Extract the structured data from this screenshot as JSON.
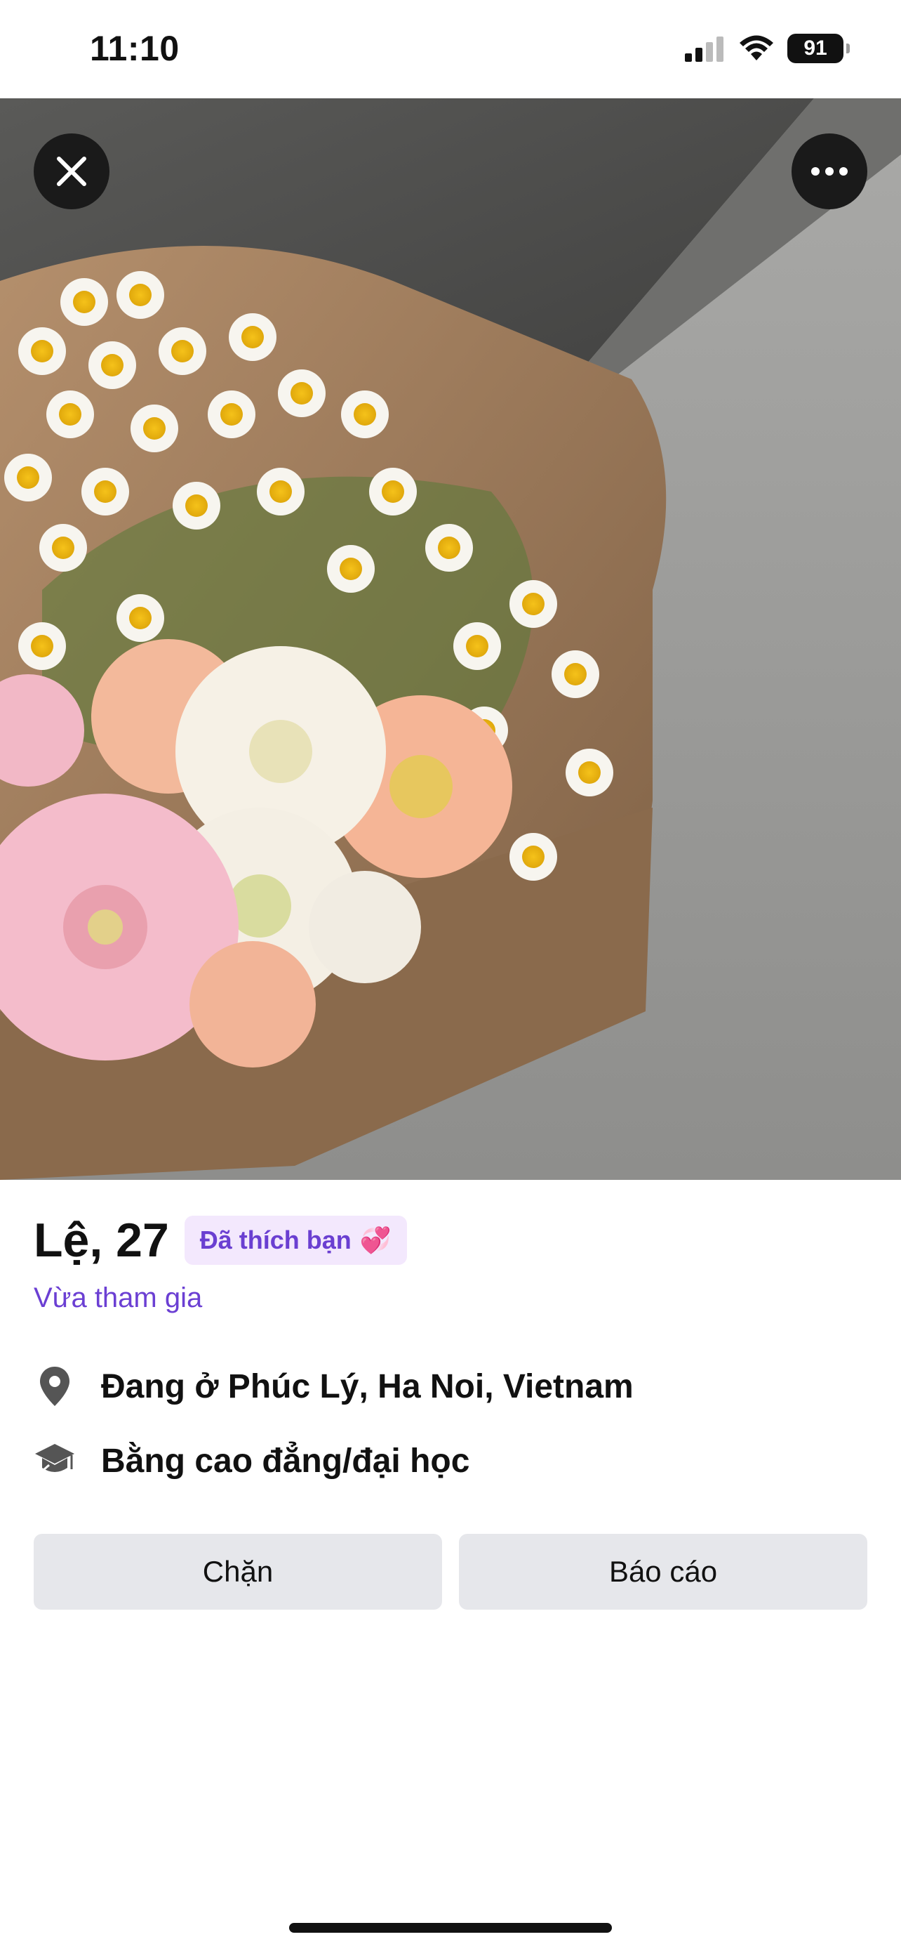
{
  "status_bar": {
    "time": "11:10",
    "battery_level": "91"
  },
  "profile": {
    "name_age": "Lệ, 27",
    "liked_badge": "Đã thích bạn",
    "liked_emoji": "💞",
    "joined": "Vừa tham gia"
  },
  "info": {
    "location": "Đang ở Phúc Lý, Ha Noi, Vietnam",
    "education": "Bằng cao đẳng/đại học"
  },
  "actions": {
    "block_label": "Chặn",
    "report_label": "Báo cáo"
  },
  "icons": {
    "close": "close-icon",
    "more": "more-icon",
    "location": "location-pin-icon",
    "education": "graduation-cap-icon"
  },
  "colors": {
    "accent": "#6a3fd1",
    "badge_bg": "#f3e8fd",
    "button_bg": "#e6e7eb"
  }
}
